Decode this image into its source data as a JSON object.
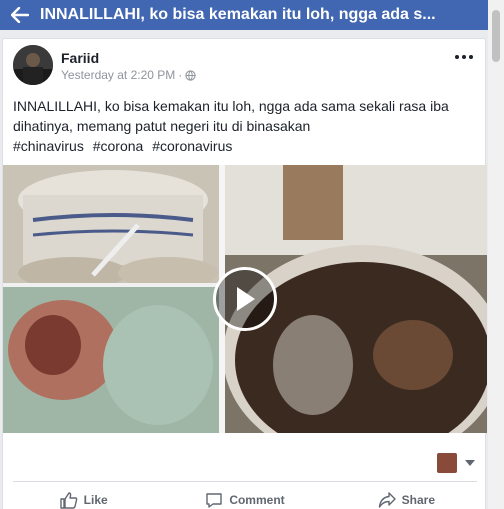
{
  "header": {
    "back_icon": "arrow-left-icon",
    "title": "INNALILLAHI, ko bisa kemakan itu loh, ngga ada s..."
  },
  "post": {
    "author": "Fariid",
    "timestamp": "Yesterday at 2:20 PM",
    "separator": "·",
    "privacy_icon": "globe-icon",
    "more_icon": "more-options-icon",
    "text": "INNALILLAHI, ko bisa kemakan itu loh, ngga ada sama sekali rasa iba dihatinya, memang patut negeri itu di binasakan",
    "hashtags": [
      "#chinavirus",
      "#corona",
      "#coronavirus"
    ]
  },
  "video": {
    "play_icon": "play-icon"
  },
  "actions": {
    "like": "Like",
    "comment": "Comment",
    "share": "Share"
  },
  "colors": {
    "brand": "#4267b2",
    "muted": "#606770"
  }
}
